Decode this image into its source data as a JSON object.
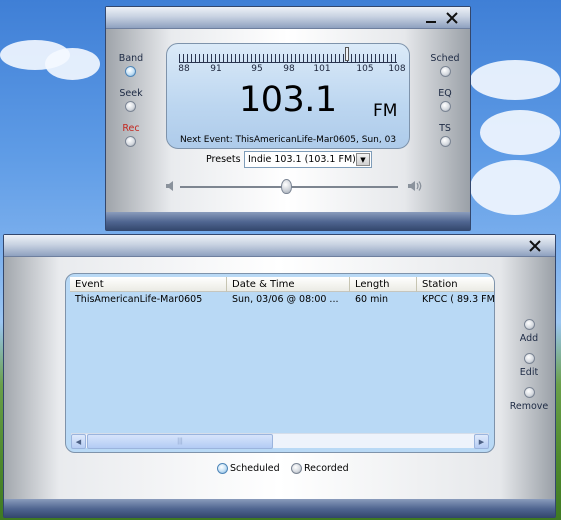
{
  "radio": {
    "left_buttons": [
      {
        "label": "Band",
        "active": true
      },
      {
        "label": "Seek",
        "active": false
      },
      {
        "label": "Rec",
        "active": false,
        "color": "#c4271f"
      }
    ],
    "right_buttons": [
      {
        "label": "Sched"
      },
      {
        "label": "EQ"
      },
      {
        "label": "TS"
      }
    ],
    "scale_labels": [
      "88",
      "91",
      "95",
      "98",
      "101",
      "105",
      "108"
    ],
    "frequency": "103.1",
    "band_unit": "FM",
    "next_event": "Next Event: ThisAmericanLife-Mar0605, Sun, 03",
    "presets_label": "Presets",
    "preset_selected": "Indie 103.1 (103.1 FM)",
    "volume_level": 0.49
  },
  "schedule": {
    "columns": [
      "Event",
      "Date & Time",
      "Length",
      "Station"
    ],
    "rows": [
      [
        "ThisAmericanLife-Mar0605",
        "Sun, 03/06 @ 08:00 ...",
        "60 min",
        "KPCC ( 89.3 FM"
      ]
    ],
    "actions": [
      "Add",
      "Edit",
      "Remove"
    ],
    "filters": [
      {
        "label": "Scheduled",
        "selected": true
      },
      {
        "label": "Recorded",
        "selected": false
      }
    ]
  },
  "colors": {
    "display_bg": "#bcd6f0",
    "list_bg": "#b9d9f5",
    "rec_label": "#c4271f",
    "frame_dark": "#35496f"
  },
  "icons": {
    "minimize": "minimize-icon",
    "close": "close-icon",
    "volume_low": "speaker-low-icon",
    "volume_high": "speaker-high-icon"
  }
}
